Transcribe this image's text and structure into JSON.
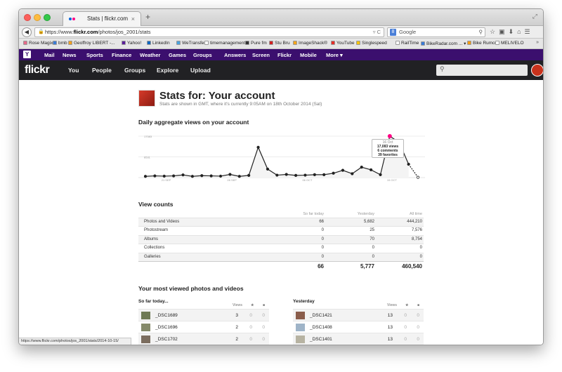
{
  "browser": {
    "tab_title": "Stats | flickr.com",
    "tab_close": "×",
    "new_tab": "+",
    "url_prefix": "https://www.",
    "url_domain": "flickr.com",
    "url_path": "/photos/jos_2001/stats",
    "search_placeholder": "Google",
    "status_url": "https://www.flickr.com/photos/jos_2001/stats/2014-10-15/"
  },
  "bookmarks": [
    {
      "label": "Rose Magix",
      "color": "#e46a8a"
    },
    {
      "label": "bmb",
      "color": "#3a7bd5"
    },
    {
      "label": "Geoffroy LIBERT -...",
      "color": "#f0a020"
    },
    {
      "label": "Yahoo!",
      "color": "#5a1f9a"
    },
    {
      "label": "LinkedIn",
      "color": "#0a66c2"
    },
    {
      "label": "WeTransfer",
      "color": "#4aa3df"
    },
    {
      "label": "timemanagement",
      "color": "#ffffff"
    },
    {
      "label": "Pure fm",
      "color": "#333333"
    },
    {
      "label": "Stu Bru",
      "color": "#d02020"
    },
    {
      "label": "ImageShack®",
      "color": "#f4a51c"
    },
    {
      "label": "YouTube",
      "color": "#e52d27"
    },
    {
      "label": "Singlespeed",
      "color": "#f5c400"
    },
    {
      "label": "RailTime",
      "color": "#ffffff"
    },
    {
      "label": "BikeRadar.com ... ▾",
      "color": "#3a7bd5"
    },
    {
      "label": "Bike Rumor",
      "color": "#f39c12"
    },
    {
      "label": "MELIVELO",
      "color": "#ffffff"
    }
  ],
  "yahoo_bar": {
    "logo": "Y",
    "items": [
      "Mail",
      "News",
      "Sports",
      "Finance",
      "Weather",
      "Games",
      "Groups",
      "Answers",
      "Screen",
      "Flickr",
      "Mobile",
      "More ▾"
    ]
  },
  "flickr": {
    "logo": "flickr",
    "nav": [
      "You",
      "People",
      "Groups",
      "Explore",
      "Upload"
    ]
  },
  "page": {
    "title": "Stats for: Your account",
    "subtitle": "Stats are shown in GMT, where it's currently 9:05AM on 18th October 2014 (Sat)",
    "chart_heading": "Daily aggregate views on your account",
    "view_counts_heading": "View counts",
    "most_viewed_heading": "Your most viewed photos and videos"
  },
  "tooltip": {
    "date": "16 Oct",
    "views": "17,083 views",
    "comments": "6 comments",
    "favorites": "39 favorites"
  },
  "chart_data": {
    "type": "line",
    "y_ticks": [
      {
        "value": 17083,
        "label": "17083"
      },
      {
        "value": 8531,
        "label": "8531"
      }
    ],
    "x_tick_labels": [
      "21 SEP",
      "28 SEP",
      "06 OCT",
      "15 OCT"
    ],
    "x": [
      "19 Sep",
      "20 Sep",
      "21 Sep",
      "22 Sep",
      "23 Sep",
      "24 Sep",
      "25 Sep",
      "26 Sep",
      "27 Sep",
      "28 Sep",
      "29 Sep",
      "30 Sep",
      "1 Oct",
      "2 Oct",
      "3 Oct",
      "4 Oct",
      "5 Oct",
      "6 Oct",
      "7 Oct",
      "8 Oct",
      "9 Oct",
      "10 Oct",
      "11 Oct",
      "12 Oct",
      "13 Oct",
      "14 Oct",
      "15 Oct",
      "16 Oct",
      "17 Oct",
      "18 Oct"
    ],
    "values": [
      500,
      700,
      600,
      700,
      1100,
      500,
      800,
      700,
      600,
      1300,
      500,
      900,
      12500,
      3500,
      1000,
      1300,
      900,
      1000,
      1200,
      1200,
      1800,
      3000,
      1600,
      4300,
      3200,
      1200,
      17083,
      14500,
      5500,
      100
    ],
    "ylim": [
      0,
      17083
    ],
    "highlight_index": 26
  },
  "view_counts": {
    "headers": [
      "So far today",
      "Yesterday",
      "All time"
    ],
    "rows": [
      {
        "label": "Photos and Videos",
        "today": "66",
        "yesterday": "5,682",
        "all": "444,210"
      },
      {
        "label": "Photostream",
        "today": "0",
        "yesterday": "25",
        "all": "7,576"
      },
      {
        "label": "Albums",
        "today": "0",
        "yesterday": "70",
        "all": "8,754"
      },
      {
        "label": "Collections",
        "today": "0",
        "yesterday": "0",
        "all": "0"
      },
      {
        "label": "Galleries",
        "today": "0",
        "yesterday": "0",
        "all": "0"
      }
    ],
    "totals": {
      "today": "66",
      "yesterday": "5,777",
      "all": "460,540"
    }
  },
  "most_viewed": {
    "today": {
      "heading": "So far today...",
      "views_label": "Views",
      "star": "★",
      "comment": "■",
      "rows": [
        {
          "name": "_DSC1689",
          "views": "3",
          "favs": "0",
          "comments": "0",
          "thumb": "#6f7a55"
        },
        {
          "name": "_DSC1696",
          "views": "2",
          "favs": "0",
          "comments": "0",
          "thumb": "#858a6a"
        },
        {
          "name": "_DSC1702",
          "views": "2",
          "favs": "0",
          "comments": "0",
          "thumb": "#7b6d5e"
        }
      ]
    },
    "yesterday": {
      "heading": "Yesterday",
      "views_label": "Views",
      "star": "★",
      "comment": "■",
      "rows": [
        {
          "name": "_DSC1421",
          "views": "13",
          "favs": "0",
          "comments": "0",
          "thumb": "#8a5d4b"
        },
        {
          "name": "_DSC1408",
          "views": "13",
          "favs": "0",
          "comments": "0",
          "thumb": "#9fb4c8"
        },
        {
          "name": "_DSC1401",
          "views": "13",
          "favs": "0",
          "comments": "0",
          "thumb": "#b7b3a2"
        }
      ]
    }
  }
}
